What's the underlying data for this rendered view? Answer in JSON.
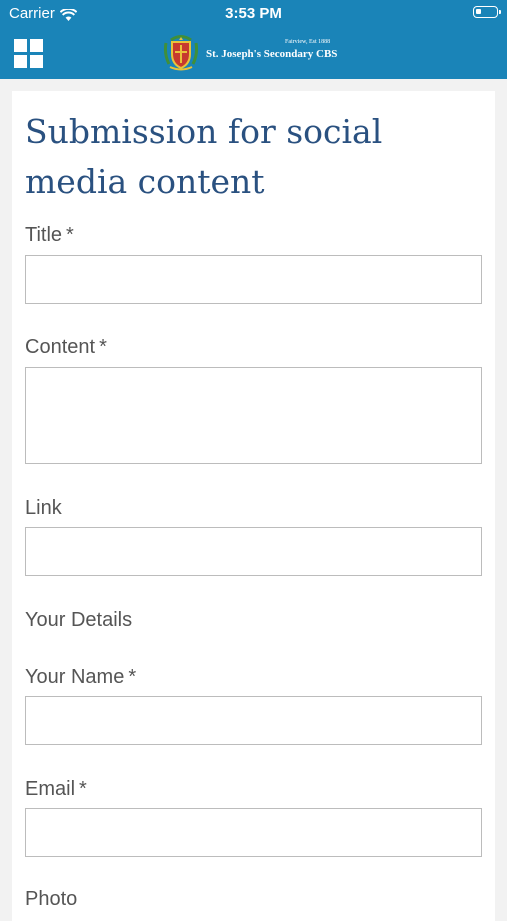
{
  "status_bar": {
    "carrier": "Carrier",
    "time": "3:53 PM",
    "battery_level": 0.3
  },
  "header": {
    "logo_tagline": "Fairview, Est 1888",
    "logo_name": "St. Joseph's Secondary CBS",
    "menu_icon": "grid-menu-icon",
    "crest_icon": "school-crest-icon",
    "background_color": "#1a84b8"
  },
  "form": {
    "title": "Submission for social media content",
    "title_color": "#2a5180",
    "fields": {
      "title": {
        "label": "Title",
        "required_mark": "*",
        "value": ""
      },
      "content": {
        "label": "Content",
        "required_mark": "*",
        "value": ""
      },
      "link": {
        "label": "Link",
        "value": ""
      },
      "your_name": {
        "label": "Your Name",
        "required_mark": "*",
        "value": ""
      },
      "email": {
        "label": "Email",
        "required_mark": "*",
        "value": ""
      },
      "photo": {
        "label": "Photo"
      }
    },
    "section_your_details": "Your Details"
  }
}
